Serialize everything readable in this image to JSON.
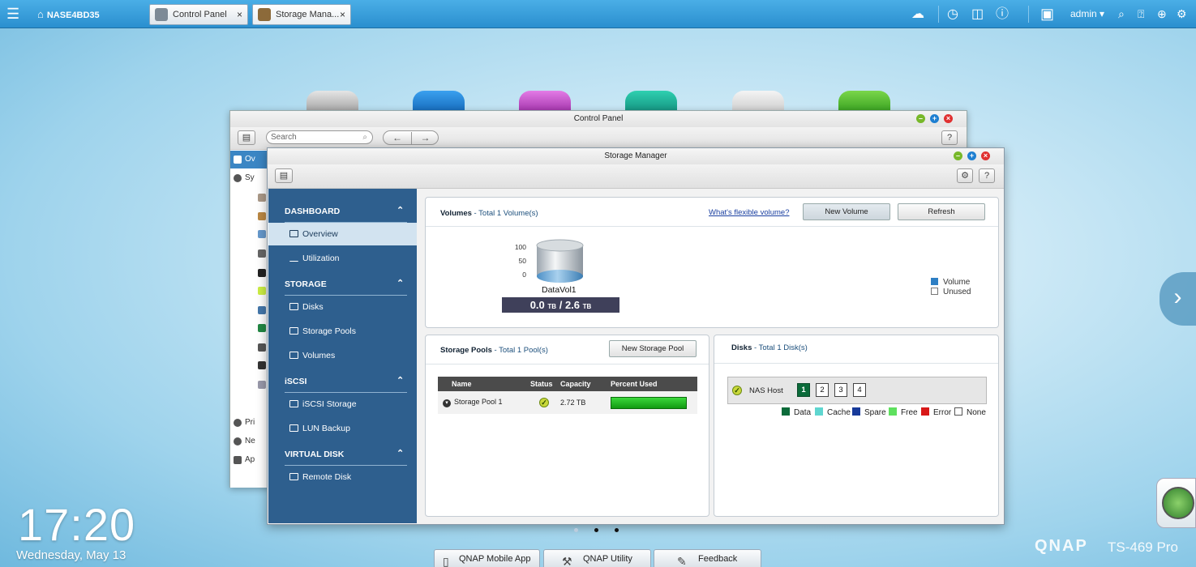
{
  "topbar": {
    "home_label": "NASE4BD35",
    "tabs": [
      {
        "label": "Control Panel",
        "close": "×"
      },
      {
        "label": "Storage Mana...",
        "close": "×"
      }
    ],
    "user": "admin ▾"
  },
  "desktop": {
    "time": "17:20",
    "date": "Wednesday, May 13",
    "brand": "QNAP",
    "model": "TS-469 Pro",
    "bottom_buttons": [
      "QNAP Mobile App",
      "QNAP Utility",
      "Feedback"
    ]
  },
  "control_panel": {
    "title": "Control Panel",
    "search_placeholder": "Search",
    "help": "?",
    "side_items": [
      "Ov",
      "Sy",
      "Pri",
      "Ne",
      "Ap"
    ]
  },
  "storage_manager": {
    "title": "Storage Manager",
    "help": "?",
    "nav": {
      "sections": [
        {
          "header": "DASHBOARD",
          "items": [
            "Overview",
            "Utilization"
          ]
        },
        {
          "header": "STORAGE",
          "items": [
            "Disks",
            "Storage Pools",
            "Volumes"
          ]
        },
        {
          "header": "iSCSI",
          "items": [
            "iSCSI Storage",
            "LUN Backup"
          ]
        },
        {
          "header": "VIRTUAL DISK",
          "items": [
            "Remote Disk"
          ]
        }
      ]
    },
    "volumes": {
      "title": "Volumes",
      "subtitle": "- Total 1 Volume(s)",
      "flex_link": "What's flexible volume?",
      "new_button": "New Volume",
      "refresh_button": "Refresh",
      "y_ticks": [
        "100",
        "50",
        "0"
      ],
      "volume_name": "DataVol1",
      "used": "0.0",
      "used_unit": "TB",
      "separator": "/",
      "total": "2.6",
      "total_unit": "TB",
      "legend": [
        {
          "label": "Volume",
          "color": "#2e7fc4"
        },
        {
          "label": "Unused",
          "color": "#ffffff"
        }
      ]
    },
    "pools": {
      "title": "Storage Pools",
      "subtitle": "- Total 1 Pool(s)",
      "new_button": "New Storage Pool",
      "columns": [
        "Name",
        "Status",
        "Capacity",
        "Percent Used"
      ],
      "rows": [
        {
          "name": "Storage Pool 1",
          "capacity": "2.72 TB"
        }
      ]
    },
    "disks": {
      "title": "Disks",
      "subtitle": "- Total 1 Disk(s)",
      "host": "NAS Host",
      "bays": [
        "1",
        "2",
        "3",
        "4"
      ],
      "legend": [
        {
          "label": "Data",
          "color": "#0b6b3a"
        },
        {
          "label": "Cache",
          "color": "#5fd6d0"
        },
        {
          "label": "Spare",
          "color": "#173a9a"
        },
        {
          "label": "Free",
          "color": "#5ee05e"
        },
        {
          "label": "Error",
          "color": "#d81818"
        },
        {
          "label": "None",
          "color": "#ffffff"
        }
      ]
    }
  }
}
